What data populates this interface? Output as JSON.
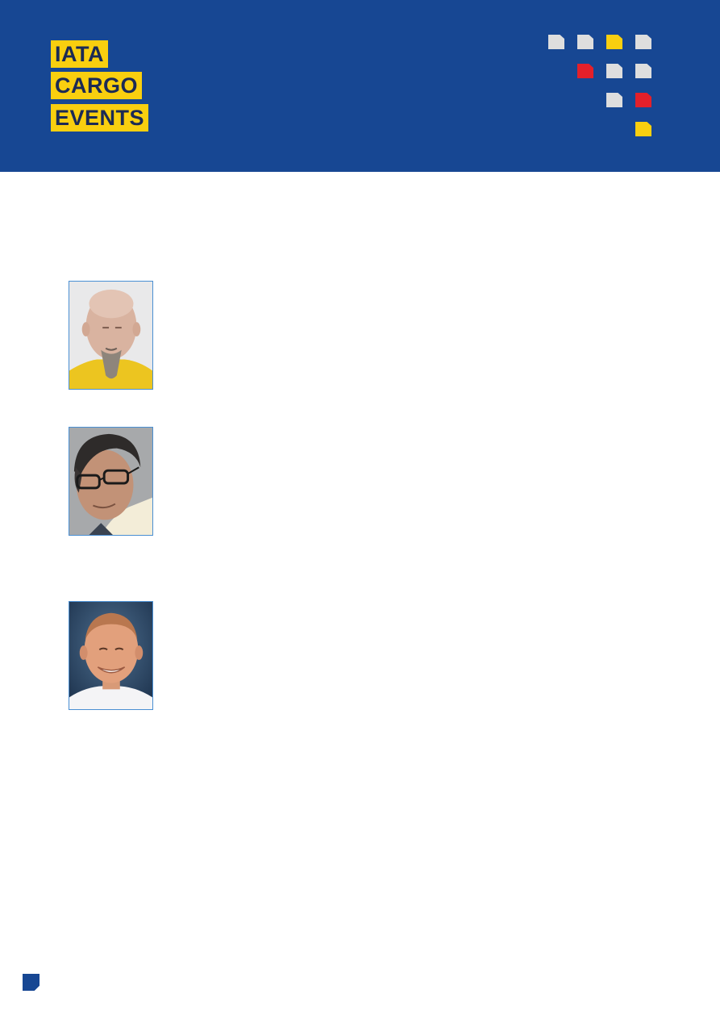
{
  "brand": {
    "logo_lines": [
      "IATA",
      "CARGO",
      "EVENTS"
    ],
    "colors": {
      "header_bg": "#174793",
      "logo_bg": "#f9cf0f",
      "logo_text": "#1b2a55",
      "square_grey": "#dedede",
      "square_yellow": "#f9cf0f",
      "square_red": "#e3202a",
      "photo_border": "#4a8fd3"
    }
  },
  "decor": {
    "squares": [
      {
        "row": 0,
        "col": 0,
        "color": "grey"
      },
      {
        "row": 0,
        "col": 1,
        "color": "grey"
      },
      {
        "row": 0,
        "col": 2,
        "color": "yellow"
      },
      {
        "row": 0,
        "col": 3,
        "color": "grey"
      },
      {
        "row": 1,
        "col": 1,
        "color": "red"
      },
      {
        "row": 1,
        "col": 2,
        "color": "grey"
      },
      {
        "row": 1,
        "col": 3,
        "color": "grey"
      },
      {
        "row": 2,
        "col": 2,
        "color": "grey"
      },
      {
        "row": 2,
        "col": 3,
        "color": "red"
      },
      {
        "row": 3,
        "col": 3,
        "color": "yellow"
      }
    ]
  },
  "speakers": [
    {
      "photo": "speaker-photo-bald-man-grey-goatee-yellow-shirt"
    },
    {
      "photo": "speaker-photo-man-glasses-white-shirt"
    },
    {
      "photo": "speaker-photo-smiling-man-white-shirt"
    }
  ]
}
